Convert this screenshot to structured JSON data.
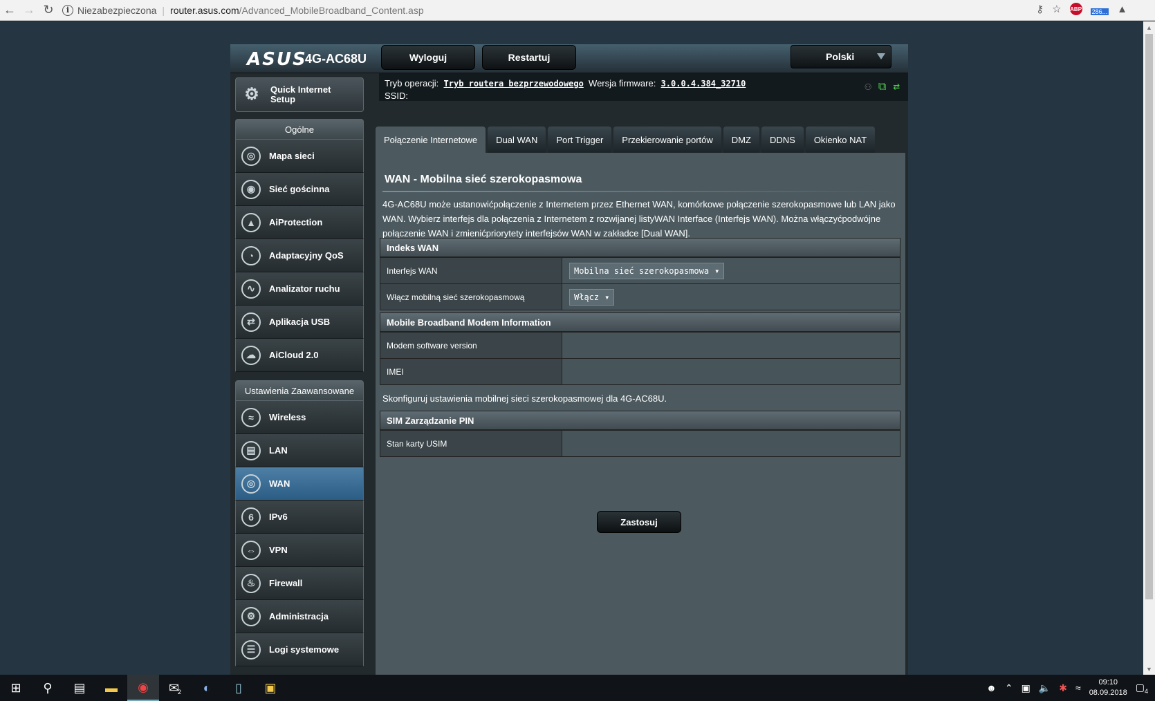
{
  "browser": {
    "security_label": "Niezabezpieczona",
    "url_host": "router.asus.com",
    "url_path": "/Advanced_MobileBroadband_Content.asp",
    "ext_badge": "286..."
  },
  "header": {
    "brand": "ASUS",
    "model": "4G-AC68U",
    "logout": "Wyloguj",
    "restart": "Restartuj",
    "language": "Polski"
  },
  "status": {
    "mode_label": "Tryb operacji:",
    "mode_value": "Tryb routera bezprzewodowego",
    "fw_label": "Wersja firmware:",
    "fw_value": "3.0.0.4.384_32710",
    "ssid_label": "SSID:"
  },
  "sidebar": {
    "qis": "Quick Internet Setup",
    "general_title": "Ogólne",
    "general": [
      {
        "label": "Mapa sieci",
        "icon": "globe-icon"
      },
      {
        "label": "Sieć gościnna",
        "icon": "guest-network-icon"
      },
      {
        "label": "AiProtection",
        "icon": "shield-icon"
      },
      {
        "label": "Adaptacyjny QoS",
        "icon": "gauge-icon"
      },
      {
        "label": "Analizator ruchu",
        "icon": "traffic-icon"
      },
      {
        "label": "Aplikacja USB",
        "icon": "usb-icon"
      },
      {
        "label": "AiCloud 2.0",
        "icon": "cloud-icon"
      }
    ],
    "advanced_title": "Ustawienia Zaawansowane",
    "advanced": [
      {
        "label": "Wireless",
        "icon": "wifi-icon"
      },
      {
        "label": "LAN",
        "icon": "lan-icon"
      },
      {
        "label": "WAN",
        "icon": "wan-icon"
      },
      {
        "label": "IPv6",
        "icon": "ipv6-icon"
      },
      {
        "label": "VPN",
        "icon": "vpn-icon"
      },
      {
        "label": "Firewall",
        "icon": "firewall-icon"
      },
      {
        "label": "Administracja",
        "icon": "gear-icon"
      },
      {
        "label": "Logi systemowe",
        "icon": "log-icon"
      }
    ]
  },
  "tabs": [
    "Połączenie Internetowe",
    "Dual WAN",
    "Port Trigger",
    "Przekierowanie portów",
    "DMZ",
    "DDNS",
    "Okienko NAT"
  ],
  "content": {
    "title": "WAN - Mobilna sieć szerokopasmowa",
    "description": "4G-AC68U może ustanowićpołączenie z Internetem przez Ethernet WAN, komórkowe połączenie szerokopasmowe lub LAN jako WAN. Wybierz interfejs dla połączenia z Internetem z rozwijanej listyWAN Interface (Interfejs WAN). Można włączyćpodwójne połączenie WAN i zmienićpriorytety interfejsów WAN w zakładce [Dual WAN].",
    "wan_index": {
      "header": "Indeks WAN",
      "iface_label": "Interfejs WAN",
      "iface_value": "Mobilna sieć szerokopasmowa",
      "enable_label": "Włącz mobilną sieć szerokopasmową",
      "enable_value": "Włącz"
    },
    "modem": {
      "header": "Mobile Broadband Modem Information",
      "sw_label": "Modem software version",
      "imei_label": "IMEI"
    },
    "note": "Skonfiguruj ustawienia mobilnej sieci szerokopasmowej dla 4G-AC68U.",
    "sim": {
      "header": "SIM Zarządzanie PIN",
      "usim_label": "Stan karty USIM"
    },
    "apply": "Zastosuj"
  },
  "taskbar": {
    "mail_badge": "2",
    "time": "09:10",
    "date": "08.09.2018",
    "notif_count": "4"
  }
}
